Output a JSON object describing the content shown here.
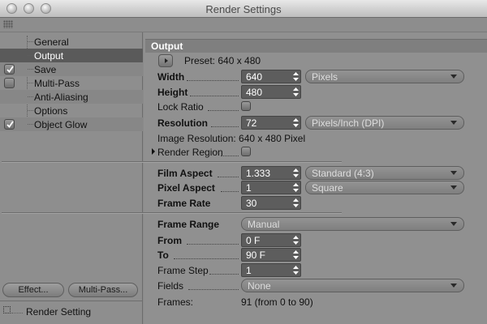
{
  "window": {
    "title": "Render Settings"
  },
  "sidebar": {
    "items": [
      {
        "label": "General"
      },
      {
        "label": "Output"
      },
      {
        "label": "Save",
        "checked": true
      },
      {
        "label": "Multi-Pass",
        "checked": false
      },
      {
        "label": "Anti-Aliasing"
      },
      {
        "label": "Options"
      },
      {
        "label": "Object Glow",
        "checked": true
      }
    ],
    "effect_button": "Effect...",
    "multipass_button": "Multi-Pass...",
    "render_setting_label": "Render Setting"
  },
  "output": {
    "section_title": "Output",
    "preset": "Preset: 640 x 480",
    "width_label": "Width",
    "width_value": "640",
    "width_unit": "Pixels",
    "height_label": "Height",
    "height_value": "480",
    "lock_ratio_label": "Lock Ratio",
    "lock_ratio_checked": false,
    "resolution_label": "Resolution",
    "resolution_value": "72",
    "resolution_unit": "Pixels/Inch (DPI)",
    "image_resolution": "Image Resolution: 640 x 480 Pixel",
    "render_region_label": "Render Region",
    "render_region_checked": false,
    "film_aspect_label": "Film Aspect",
    "film_aspect_value": "1.333",
    "film_aspect_preset": "Standard (4:3)",
    "pixel_aspect_label": "Pixel Aspect",
    "pixel_aspect_value": "1",
    "pixel_aspect_preset": "Square",
    "frame_rate_label": "Frame Rate",
    "frame_rate_value": "30",
    "frame_range_label": "Frame Range",
    "frame_range_value": "Manual",
    "from_label": "From",
    "from_value": "0 F",
    "to_label": "To",
    "to_value": "90 F",
    "frame_step_label": "Frame Step",
    "frame_step_value": "1",
    "fields_label": "Fields",
    "fields_value": "None",
    "frames_label": "Frames:",
    "frames_value": "91 (from 0 to 90)"
  }
}
